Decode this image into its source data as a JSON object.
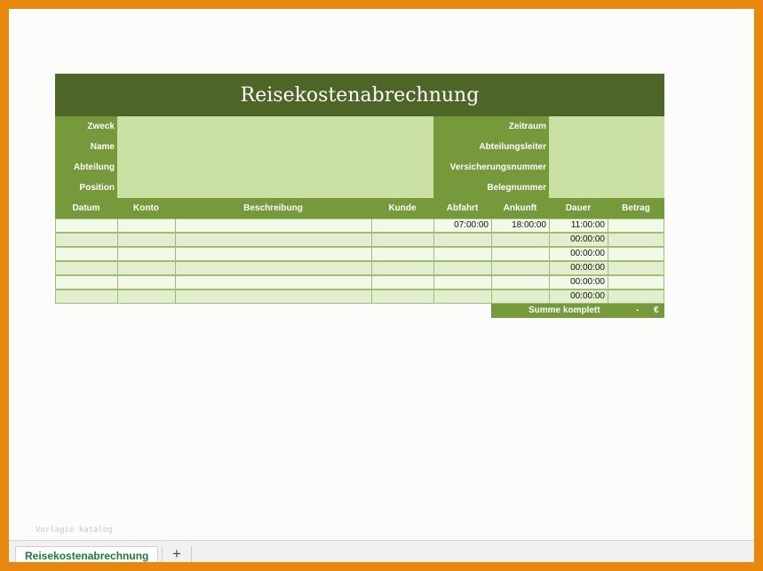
{
  "sheet": {
    "title": "Reisekostenabrechnung",
    "left_labels": [
      "Zweck",
      "Name",
      "Abteilung",
      "Position"
    ],
    "right_labels": [
      "Zeitraum",
      "Abteilungsleiter",
      "Versicherungsnummer",
      "Belegnummer"
    ],
    "columns": [
      "Datum",
      "Konto",
      "Beschreibung",
      "Kunde",
      "Abfahrt",
      "Ankunft",
      "Dauer",
      "Betrag"
    ],
    "rows": [
      [
        "",
        "",
        "",
        "",
        "07:00:00",
        "18:00:00",
        "11:00:00",
        ""
      ],
      [
        "",
        "",
        "",
        "",
        "",
        "",
        "00:00:00",
        ""
      ],
      [
        "",
        "",
        "",
        "",
        "",
        "",
        "00:00:00",
        ""
      ],
      [
        "",
        "",
        "",
        "",
        "",
        "",
        "00:00:00",
        ""
      ],
      [
        "",
        "",
        "",
        "",
        "",
        "",
        "00:00:00",
        ""
      ],
      [
        "",
        "",
        "",
        "",
        "",
        "",
        "00:00:00",
        ""
      ]
    ],
    "total_label": "Summe komplett",
    "total_value": "-",
    "currency": "€"
  },
  "watermark": "Vorlagie katalog",
  "tabs": {
    "active": "Reisekostenabrechnung",
    "add_label": "+"
  },
  "colors": {
    "title_bg": "#4d6526",
    "header_bg": "#76993c",
    "field_bg": "#cbe1a3",
    "row_light": "#f3f9e9",
    "row_dark": "#e2eecd",
    "tab_text": "#1d7a3c",
    "frame": "#e8870e"
  }
}
